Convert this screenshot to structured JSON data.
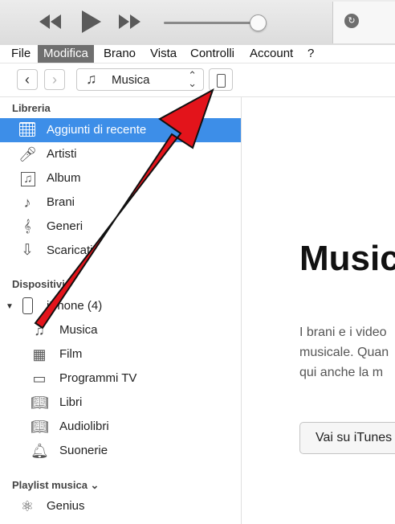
{
  "player": {
    "icons": [
      "previous-icon",
      "play-icon",
      "next-icon",
      "volume-slider",
      "itunes-status-icon"
    ],
    "volume_level": 0.9
  },
  "menubar": {
    "items": [
      "File",
      "Modifica",
      "Brano",
      "Vista",
      "Controlli",
      "Account",
      "?"
    ],
    "active": "Modifica"
  },
  "toolbar": {
    "back_label": "‹",
    "forward_label": "›",
    "media_select": "Musica",
    "chevron": "⌃⌄"
  },
  "sidebar": {
    "library_title": "Libreria",
    "library_items": [
      {
        "label": "Aggiunti di recente",
        "icon": "grid-icon"
      },
      {
        "label": "Artisti",
        "icon": "microphone-icon"
      },
      {
        "label": "Album",
        "icon": "album-icon"
      },
      {
        "label": "Brani",
        "icon": "music-note-icon"
      },
      {
        "label": "Generi",
        "icon": "guitars-icon"
      },
      {
        "label": "Scaricati",
        "icon": "download-icon"
      }
    ],
    "devices_title": "Dispositivi",
    "device_name": "iPhone (4)",
    "device_items": [
      {
        "label": "Musica",
        "icon": "music-note-icon"
      },
      {
        "label": "Film",
        "icon": "film-icon"
      },
      {
        "label": "Programmi TV",
        "icon": "tv-icon"
      },
      {
        "label": "Libri",
        "icon": "book-icon"
      },
      {
        "label": "Audiolibri",
        "icon": "audiobook-icon"
      },
      {
        "label": "Suonerie",
        "icon": "bell-icon"
      }
    ],
    "playlist_title": "Playlist musica ⌄",
    "playlist_items": [
      {
        "label": "Genius",
        "icon": "atom-icon"
      }
    ]
  },
  "main": {
    "title": "Music",
    "paragraph": [
      "I brani e i video",
      "musicale. Quan",
      "qui anche la m"
    ],
    "button": "Vai su iTunes"
  },
  "colors": {
    "selection": "#3d8ee8",
    "menu_active": "#6f6f6f",
    "arrow": "#e3141b"
  }
}
